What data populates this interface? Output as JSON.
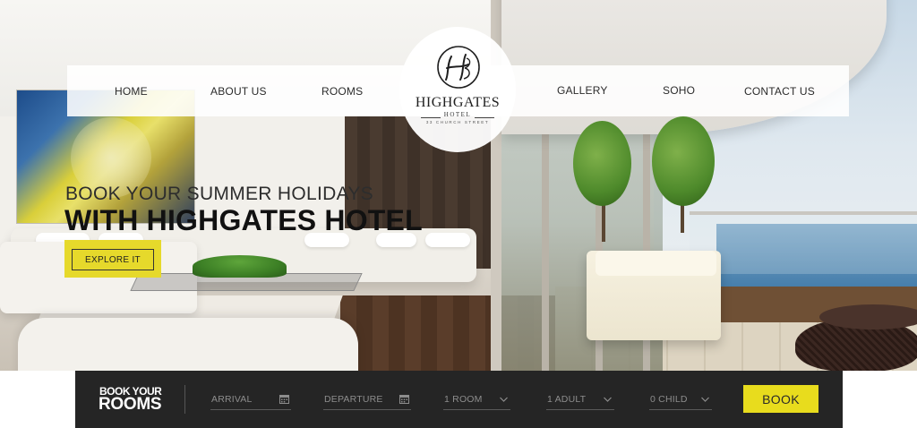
{
  "nav": {
    "items": [
      "HOME",
      "ABOUT US",
      "ROOMS",
      "GALLERY",
      "SOHO",
      "CONTACT US"
    ]
  },
  "logo": {
    "name": "HIGHGATES",
    "sub": "HOTEL",
    "street": "33 CHURCH STREET",
    "monogram": "HG-monogram-icon"
  },
  "hero": {
    "line1": "BOOK YOUR SUMMER HOLIDAYS",
    "line2": "WITH HIGHGATES HOTEL",
    "cta_label": "EXPLORE IT",
    "cta_color": "#e6d92b"
  },
  "booking": {
    "title_small": "BOOK YOUR",
    "title_big": "ROOMS",
    "arrival_placeholder": "ARRIVAL",
    "departure_placeholder": "DEPARTURE",
    "rooms_value": "1 ROOM",
    "adults_value": "1 ADULT",
    "child_value": "0 CHILD",
    "book_label": "BOOK",
    "book_color": "#e8dc1d",
    "bar_color": "#252525",
    "calendar_icon": "calendar-icon",
    "dropdown_icon": "chevron-down-icon"
  }
}
